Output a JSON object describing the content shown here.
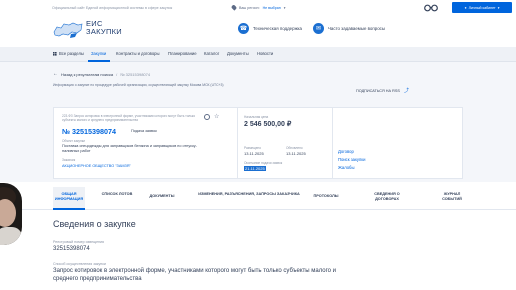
{
  "top": {
    "portal_text": "Официальный сайт Единой информационной системы в сфере закупок",
    "region_label": "Ваш регион:",
    "region_value": "Не выбран",
    "login_label": "Личный кабинет"
  },
  "header": {
    "logo_line1": "ЕИС",
    "logo_line2": "ЗАКУПКИ",
    "support_label": "Техническая поддержка",
    "faq_label": "Часто задаваемые вопросы"
  },
  "nav": {
    "items": [
      {
        "label": "Все разделы"
      },
      {
        "label": "Закупки"
      },
      {
        "label": "Контракты и договоры"
      },
      {
        "label": "Планирование"
      },
      {
        "label": "Каталог"
      },
      {
        "label": "Документы"
      },
      {
        "label": "Новости"
      }
    ]
  },
  "breadcrumb": {
    "back_label": "Назад к результатам поиска",
    "separator": "/",
    "current": "№ 32515398074"
  },
  "info_line": "Информация о закупке по процедуре рабочей организации, осуществляющей закупку Москва МСК (UTC+3)",
  "rss_label": "ПОДПИСАТЬСЯ НА RSS",
  "card": {
    "procedure_type": "223-ФЗ Запрос котировок в электронной форме, участниками которого могут быть только субъекты малого и среднего предпринимательства",
    "reg_number": "№ 32515398074",
    "stage": "Подача заявок",
    "object_label": "Объект закупки",
    "object_text": "Поставка спецодежды для заправщиков бензина и заправщиков по отпуску-наливных работ",
    "org_label": "Заказчик",
    "org_name": "АКЦИОНЕРНОЕ ОБЩЕСТВО \"ЗАМЗЯ\"",
    "price_label": "Начальная цена",
    "price": "2 546 500,00 ₽",
    "placed_label": "Размещено",
    "placed_value": "13.11.2025",
    "updated_label": "Обновлено",
    "updated_value": "13.11.2025",
    "end_label": "Окончание подачи заявок",
    "end_value": "21.11.2025",
    "links": [
      "Договор",
      "Поиск закупки",
      "Жалобы"
    ]
  },
  "tabs": [
    {
      "label": "Общая информация"
    },
    {
      "label": "Список лотов"
    },
    {
      "label": "Документы"
    },
    {
      "label": "Изменения, разъяснения, запросы заказчика"
    },
    {
      "label": "Протоколы"
    },
    {
      "label": "Сведения о договорах"
    },
    {
      "label": "Журнал событий"
    }
  ],
  "main": {
    "section_title": "Сведения о закупке",
    "reg_label": "Реестровый номер извещения",
    "reg_value": "32515398074",
    "method_label": "Способ осуществления закупки",
    "method_value": "Запрос котировок в электронной форме, участниками которого могут быть только субъекты малого и среднего предпринимательства"
  }
}
